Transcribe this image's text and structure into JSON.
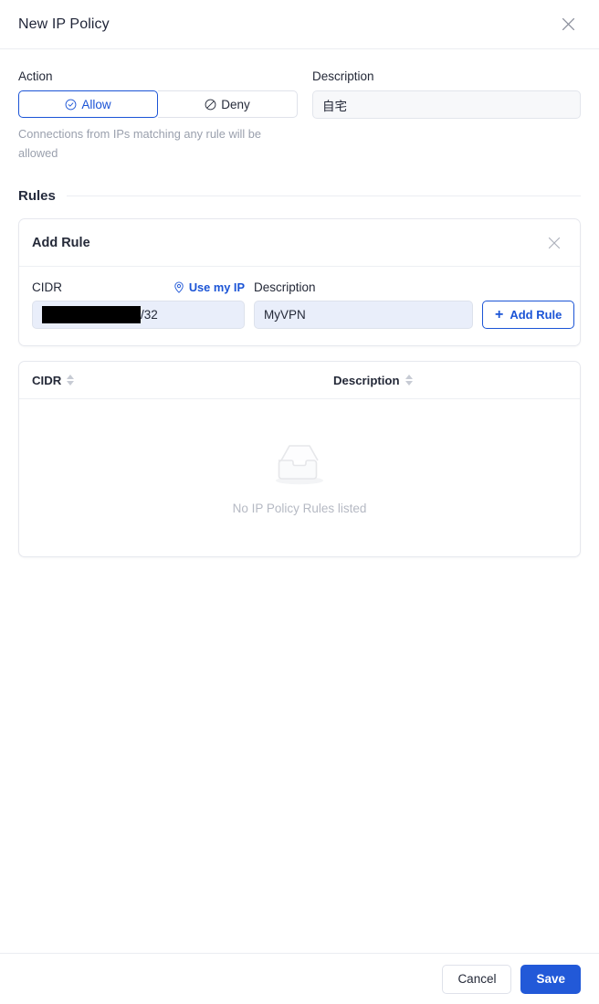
{
  "header": {
    "title": "New IP Policy",
    "close_icon": "close-x-icon"
  },
  "action": {
    "label": "Action",
    "allow_label": "Allow",
    "allow_icon": "check-circle-icon",
    "deny_label": "Deny",
    "deny_icon": "ban-circle-icon",
    "selected": "Allow",
    "hint": "Connections from IPs matching any rule will be allowed"
  },
  "description": {
    "label": "Description",
    "value": "自宅",
    "placeholder": ""
  },
  "rules_section": {
    "title": "Rules"
  },
  "add_rule_card": {
    "title": "Add Rule",
    "close_icon": "close-x-icon",
    "cidr": {
      "label": "CIDR",
      "use_my_ip_label": "Use my IP",
      "use_my_ip_icon": "location-pin-icon",
      "value_redacted": "",
      "suffix": "/32"
    },
    "description": {
      "label": "Description",
      "value": "MyVPN",
      "placeholder": ""
    },
    "add_button": {
      "label": "Add Rule",
      "icon": "plus-icon"
    }
  },
  "rules_table": {
    "columns": [
      {
        "label": "CIDR",
        "sortable": true
      },
      {
        "label": "Description",
        "sortable": true
      }
    ],
    "rows": [],
    "empty_text": "No IP Policy Rules listed",
    "empty_icon": "empty-inbox-tray-icon"
  },
  "footer": {
    "cancel_label": "Cancel",
    "save_label": "Save"
  },
  "colors": {
    "accent_blue": "#1b54d6",
    "save_blue": "#2259d8",
    "input_blue_bg": "#e9eefa",
    "input_gray_bg": "#f7f8fa",
    "text_dark": "#242938",
    "text_muted": "#9aa0ad",
    "border": "#e6e8ee"
  }
}
